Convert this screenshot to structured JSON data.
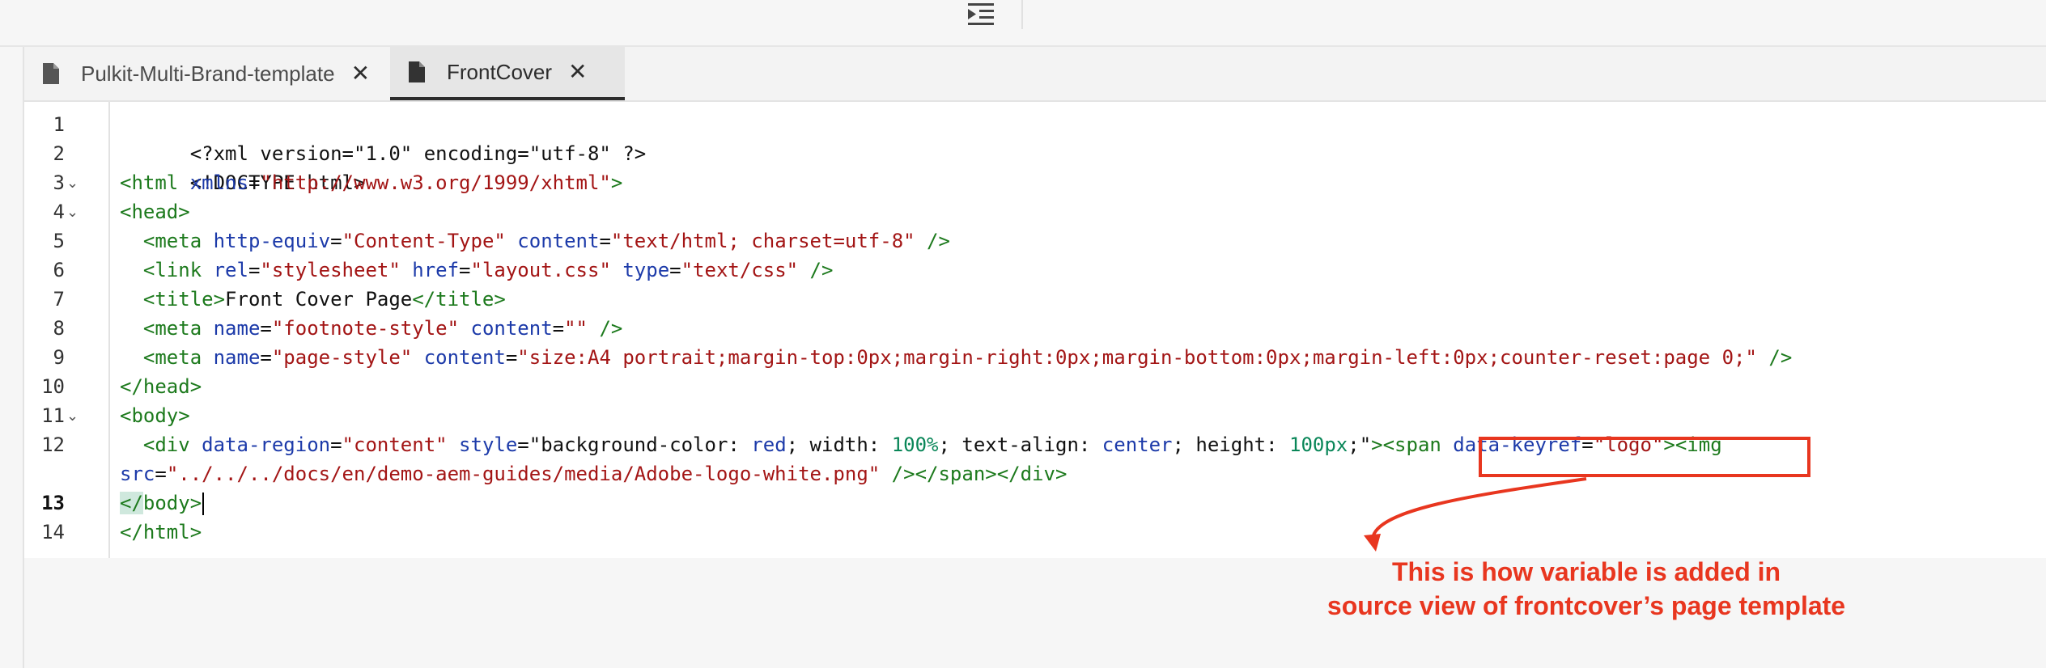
{
  "tabs": [
    {
      "label": "Pulkit-Multi-Brand-template",
      "close": "✕"
    },
    {
      "label": "FrontCover",
      "close": "✕"
    }
  ],
  "line_numbers": [
    "1",
    "2",
    "3",
    "4",
    "5",
    "6",
    "7",
    "8",
    "9",
    "10",
    "11",
    "12",
    "13",
    "14"
  ],
  "code": {
    "l1": "<?xml version=\"1.0\" encoding=\"utf-8\" ?>",
    "l2": "<!DOCTYPE html>",
    "l3_tag": "<html",
    "l3_attr": " xmlns",
    "l3_eq": "=",
    "l3_val": "\"http://www.w3.org/1999/xhtml\"",
    "l3_end": ">",
    "l4": "<head>",
    "l5_tag": "  <meta",
    "l5_a1": " http-equiv",
    "l5_v1": "\"Content-Type\"",
    "l5_a2": " content",
    "l5_v2": "\"text/html; charset=utf-8\"",
    "l5_end": " />",
    "l6_tag": "  <link",
    "l6_a1": " rel",
    "l6_v1": "\"stylesheet\"",
    "l6_a2": " href",
    "l6_v2": "\"layout.css\"",
    "l6_a3": " type",
    "l6_v3": "\"text/css\"",
    "l6_end": " />",
    "l7_open": "  <title>",
    "l7_text": "Front Cover Page",
    "l7_close": "</title>",
    "l8_tag": "  <meta",
    "l8_a1": " name",
    "l8_v1": "\"footnote-style\"",
    "l8_a2": " content",
    "l8_v2": "\"\"",
    "l8_end": " />",
    "l9_tag": "  <meta",
    "l9_a1": " name",
    "l9_v1": "\"page-style\"",
    "l9_a2": " content",
    "l9_v2": "\"size:A4 portrait;margin-top:0px;margin-right:0px;margin-bottom:0px;margin-left:0px;counter-reset:page 0;\"",
    "l9_end": " />",
    "l10": "</head>",
    "l11": "<body>",
    "l12_tag": "  <div",
    "l12_a1": " data-region",
    "l12_v1": "\"content\"",
    "l12_a2": " style",
    "l12_q1": "\"",
    "l12_s1": "background-color: ",
    "l12_s2": "red",
    "l12_s3": "; width: ",
    "l12_s4": "100%",
    "l12_s5": "; text-align: ",
    "l12_s6": "center",
    "l12_s7": "; height: ",
    "l12_s8": "100px",
    "l12_s9": ";",
    "l12_q2": "\"",
    "l12_gt": ">",
    "l12_span": "<span",
    "l12_a3": " data-keyref",
    "l12_v3": "\"logo\"",
    "l12_gt2": ">",
    "l12_img": "<img",
    "l12b_a": "src",
    "l12b_v": "\"../../../docs/en/demo-aem-guides/media/Adobe-logo-white.png\"",
    "l12b_end": " /></span></div>",
    "l13_a": "</",
    "l13_b": "body>",
    "l14": "</html>"
  },
  "annotation": {
    "line1": "This is how variable is added in",
    "line2": "source view of frontcover’s page template"
  },
  "colors": {
    "annotation": "#e8361f",
    "tag": "#1d7a1d",
    "attr": "#1c3aa9",
    "value": "#a31515"
  }
}
